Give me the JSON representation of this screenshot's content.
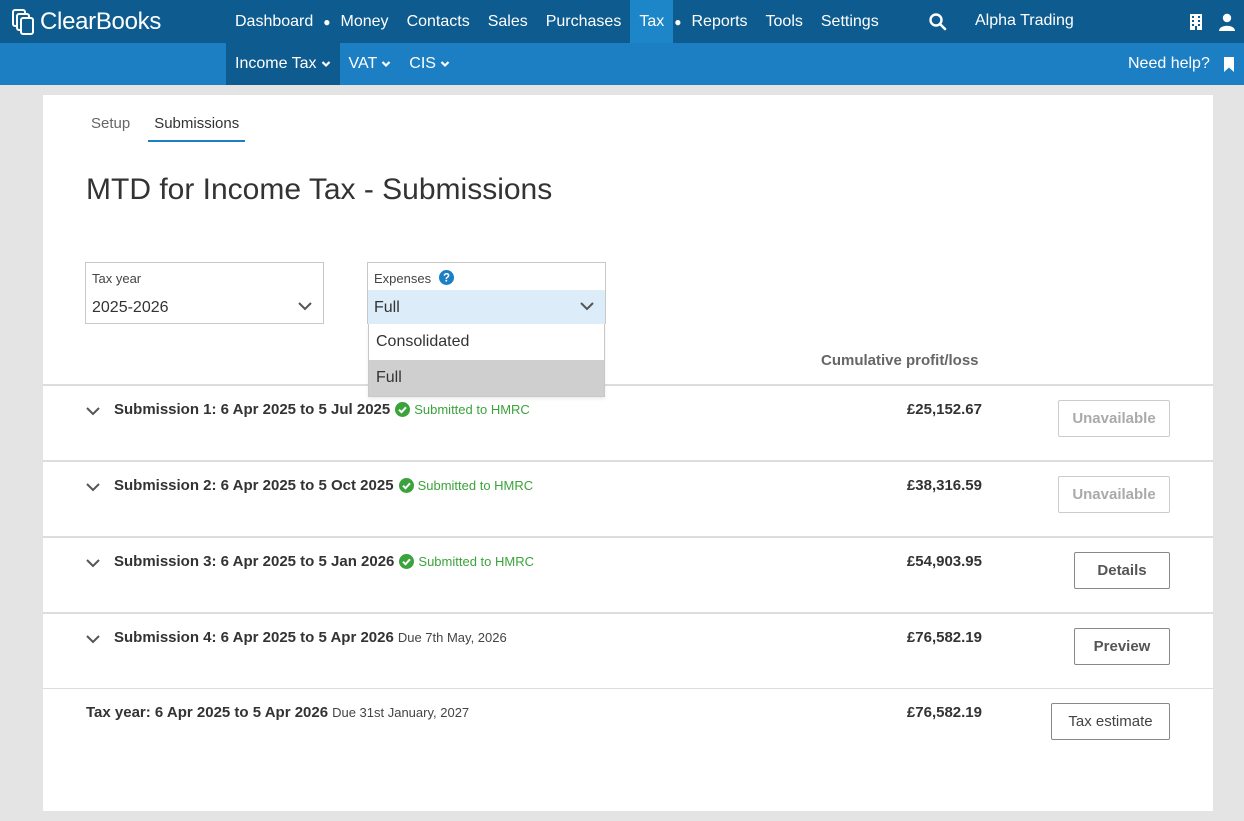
{
  "app": {
    "name": "ClearBooks"
  },
  "nav": {
    "items": [
      "Dashboard",
      "Money",
      "Contacts",
      "Sales",
      "Purchases",
      "Tax",
      "Reports",
      "Tools",
      "Settings"
    ],
    "active": "Tax",
    "company": "Alpha Trading"
  },
  "subnav": {
    "items": [
      "Income Tax",
      "VAT",
      "CIS"
    ],
    "active": "Income Tax",
    "help": "Need help?"
  },
  "tabs": [
    "Setup",
    "Submissions"
  ],
  "active_tab": "Submissions",
  "page_title": "MTD for Income Tax - Submissions",
  "tax_year": {
    "label": "Tax year",
    "value": "2025-2026"
  },
  "expenses": {
    "label": "Expenses",
    "value": "Full",
    "options": [
      "Consolidated",
      "Full"
    ],
    "selected": "Full"
  },
  "cumulative_header": "Cumulative profit/loss",
  "submissions": [
    {
      "title": "Submission 1: 6 Apr 2025 to 5 Jul 2025",
      "status": "Submitted to HMRC",
      "amount": "£25,152.67",
      "action": "Unavailable"
    },
    {
      "title": "Submission 2: 6 Apr 2025 to 5 Oct 2025",
      "status": "Submitted to HMRC",
      "amount": "£38,316.59",
      "action": "Unavailable"
    },
    {
      "title": "Submission 3: 6 Apr 2025 to 5 Jan 2026",
      "status": "Submitted to HMRC",
      "amount": "£54,903.95",
      "action": "Details"
    },
    {
      "title": "Submission 4: 6 Apr 2025 to 5 Apr 2026",
      "due": "Due 7th May, 2026",
      "amount": "£76,582.19",
      "action": "Preview"
    }
  ],
  "tax_year_row": {
    "title": "Tax year: 6 Apr 2025 to 5 Apr 2026",
    "due": "Due 31st January, 2027",
    "amount": "£76,582.19",
    "action": "Tax estimate"
  },
  "colors": {
    "topbar": "#0d5b8f",
    "subbar": "#1c7fc4",
    "status_green": "#3ba33b"
  }
}
